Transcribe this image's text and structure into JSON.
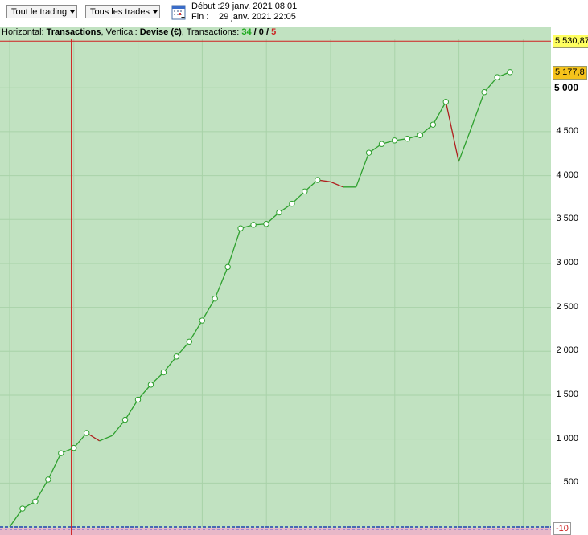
{
  "toolbar": {
    "dropdown1_label": "Tout le trading",
    "dropdown2_label": "Tous les trades",
    "calendar_icon": "calendar-icon",
    "start_label": "Début :",
    "start_value": "29 janv. 2021 08:01",
    "end_label": "Fin :",
    "end_value": "29 janv. 2021 22:05"
  },
  "infobar": {
    "horizontal_label": "Horizontal: ",
    "horizontal_value": "Transactions",
    "vertical_label": ", Vertical: ",
    "vertical_value": "Devise (€)",
    "transactions_label": ", Transactions: ",
    "count_win": "34",
    "sep1": " / ",
    "count_even": "0",
    "sep2": " / ",
    "count_loss": "5"
  },
  "price_labels": {
    "top": "5 530,87",
    "current": "5 177,8",
    "negative": "-10"
  },
  "colors": {
    "plot_bg": "#c1e2c1",
    "grid": "#a8d2a8",
    "win_line": "#2ea02e",
    "loss_line": "#b01e1e",
    "marker_fill": "#ffffff",
    "top_label_bg": "#ffff60",
    "current_label_bg": "#f5c21b",
    "bottom_band": "#e8b8c8"
  },
  "chart_data": {
    "type": "line",
    "xlabel": "Transactions",
    "ylabel": "Devise (€)",
    "ylim": [
      0,
      5600
    ],
    "yticks": [
      500,
      1000,
      1500,
      2000,
      2500,
      3000,
      3500,
      4000,
      4500,
      5000
    ],
    "ytick_labels": [
      "500",
      "1 000",
      "1 500",
      "2 000",
      "2 500",
      "3 000",
      "3 500",
      "4 000",
      "4 500",
      "5 000"
    ],
    "grid": true,
    "x": [
      0,
      1,
      2,
      3,
      4,
      5,
      6,
      7,
      8,
      9,
      10,
      11,
      12,
      13,
      14,
      15,
      16,
      17,
      18,
      19,
      20,
      21,
      22,
      23,
      24,
      25,
      26,
      27,
      28,
      29,
      30,
      31,
      32,
      33,
      34,
      35,
      36,
      37,
      38,
      39,
      40
    ],
    "y": [
      0,
      210,
      290,
      540,
      840,
      900,
      1070,
      980,
      1040,
      1220,
      1450,
      1620,
      1760,
      1940,
      2110,
      2350,
      2600,
      2960,
      3400,
      3440,
      3450,
      3580,
      3680,
      3820,
      3950,
      3930,
      3870,
      3870,
      4260,
      4360,
      4400,
      4420,
      4460,
      4580,
      4840,
      4160,
      4550,
      4950,
      5120,
      5178
    ],
    "markers": [
      false,
      true,
      true,
      true,
      true,
      true,
      true,
      false,
      false,
      true,
      true,
      true,
      true,
      true,
      true,
      true,
      true,
      true,
      true,
      true,
      true,
      true,
      true,
      true,
      true,
      false,
      false,
      false,
      true,
      true,
      true,
      true,
      true,
      true,
      true,
      false,
      false,
      true,
      true,
      true
    ],
    "loss_segments": [
      6,
      24,
      25,
      34
    ],
    "reference_lines": {
      "max_value": 5530.87,
      "current_value": 5177.8,
      "vertical_cursor_x": 4.8
    }
  }
}
